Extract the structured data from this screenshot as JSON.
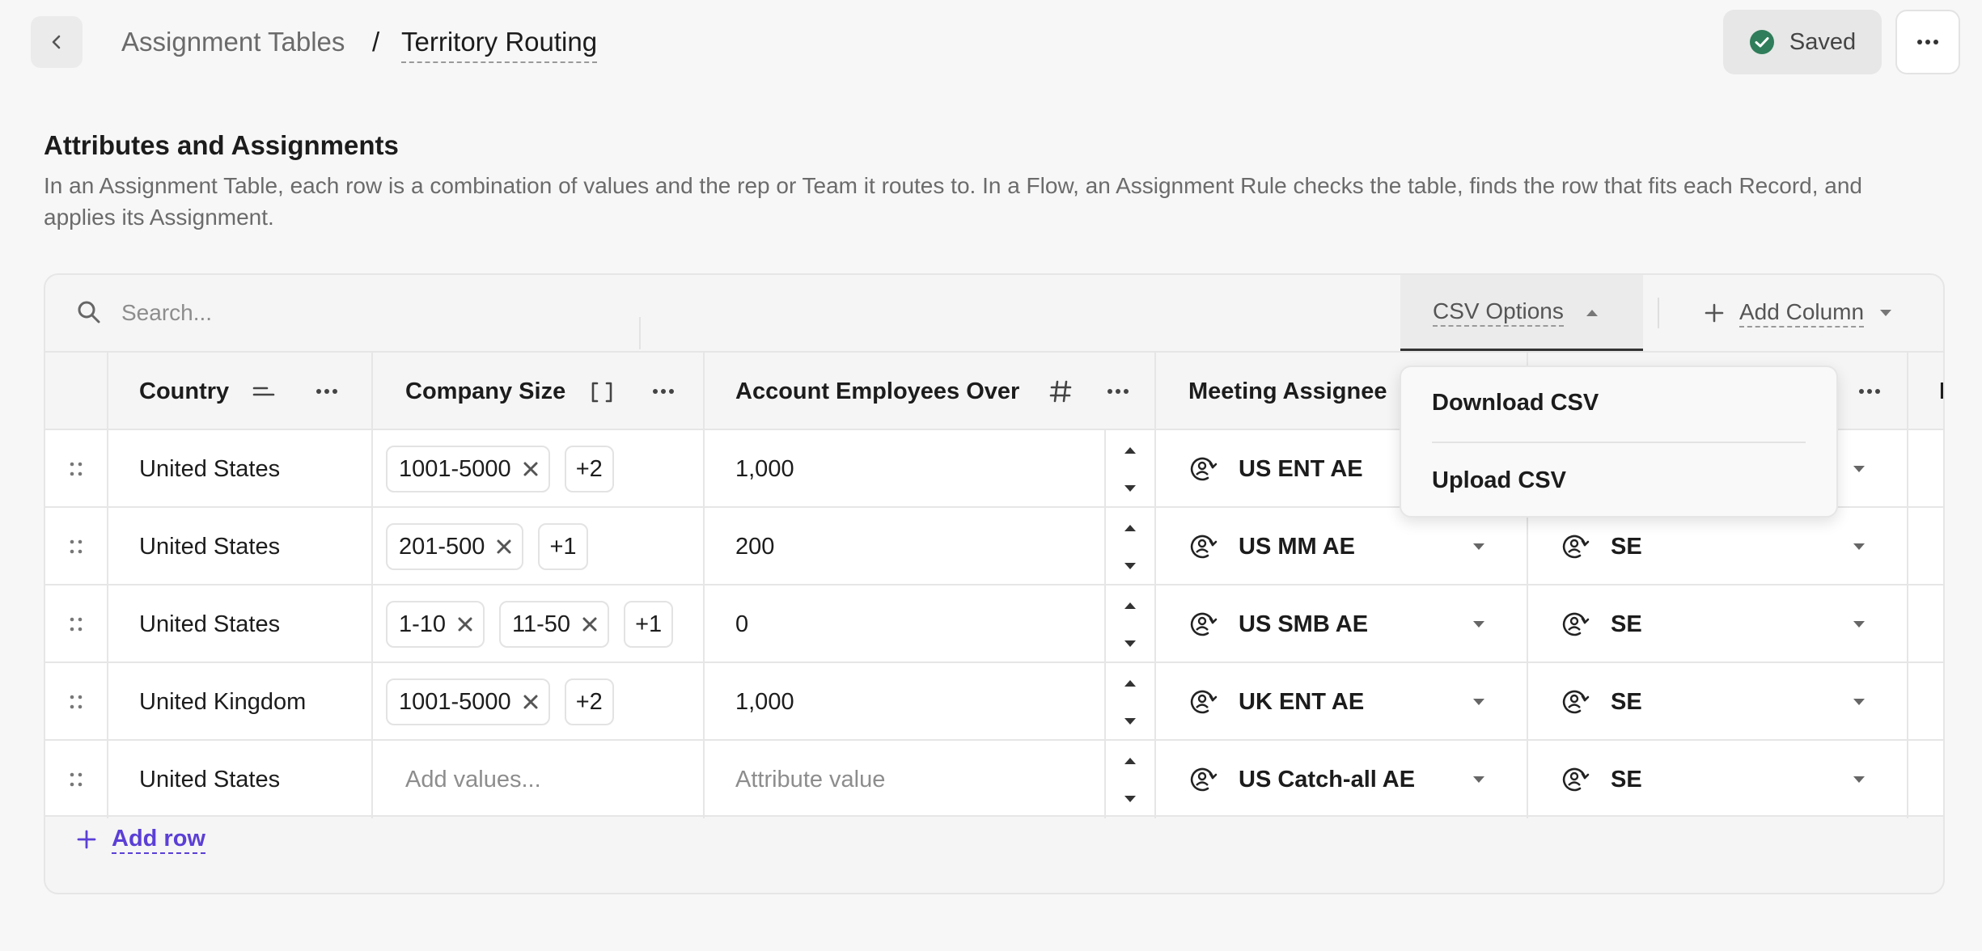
{
  "header": {
    "breadcrumb_parent": "Assignment Tables",
    "breadcrumb_separator": "/",
    "breadcrumb_current": "Territory Routing",
    "saved_label": "Saved"
  },
  "section": {
    "title": "Attributes and Assignments",
    "description": "In an Assignment Table, each row is a combination of values and the rep or Team it routes to. In a Flow, an Assignment Rule checks the table, finds the row that fits each Record, and applies its Assignment."
  },
  "toolbar": {
    "search_placeholder": "Search...",
    "csv_options_label": "CSV Options",
    "add_column_label": "Add Column"
  },
  "columns": {
    "country": "Country",
    "company_size": "Company Size",
    "account_employees": "Account Employees Over",
    "meeting_assignee": "Meeting Assignee"
  },
  "rows": [
    {
      "country": "United States",
      "sizes": [
        "1001-5000"
      ],
      "more": "+2",
      "employees": "1,000",
      "assignee": "US ENT AE",
      "second": ""
    },
    {
      "country": "United States",
      "sizes": [
        "201-500"
      ],
      "more": "+1",
      "employees": "200",
      "assignee": "US MM AE",
      "second": "SE"
    },
    {
      "country": "United States",
      "sizes": [
        "1-10",
        "11-50"
      ],
      "more": "+1",
      "employees": "0",
      "assignee": "US SMB AE",
      "second": "SE"
    },
    {
      "country": "United Kingdom",
      "sizes": [
        "1001-5000"
      ],
      "more": "+2",
      "employees": "1,000",
      "assignee": "UK ENT AE",
      "second": "SE"
    },
    {
      "country": "United States",
      "sizes": [],
      "more": "",
      "employees": "",
      "assignee": "US Catch-all AE",
      "second": "SE"
    }
  ],
  "placeholders": {
    "add_values": "Add values...",
    "attribute_value": "Attribute value"
  },
  "add_row_label": "Add row",
  "csv_menu": {
    "download": "Download CSV",
    "upload": "Upload CSV"
  },
  "colors": {
    "accent": "#5b3fd6",
    "saved_check": "#2f7d5a"
  }
}
